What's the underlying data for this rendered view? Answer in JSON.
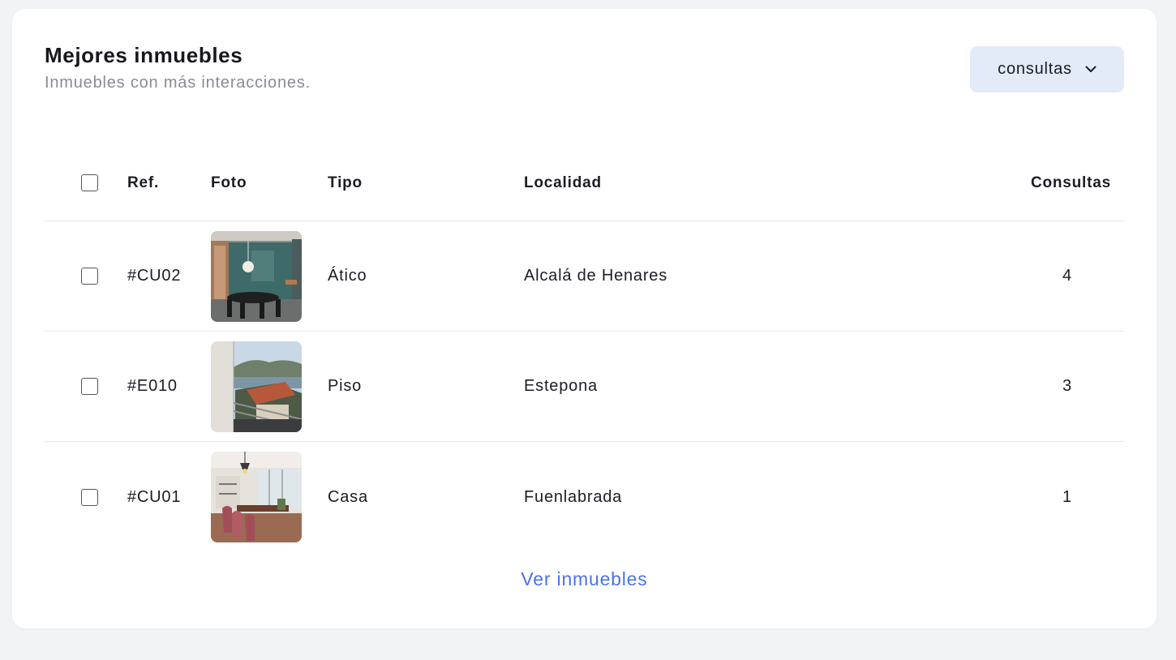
{
  "card": {
    "title": "Mejores inmuebles",
    "subtitle": "Inmuebles con más interacciones.",
    "sort_select": {
      "value": "consultas",
      "icon": "chevron-down-icon"
    }
  },
  "table": {
    "headers": {
      "ref": "Ref.",
      "foto": "Foto",
      "tipo": "Tipo",
      "localidad": "Localidad",
      "consultas": "Consultas"
    },
    "rows": [
      {
        "ref": "#CU02",
        "tipo": "Ático",
        "localidad": "Alcalá de Henares",
        "consultas": "4",
        "photo": "dining-room-photo"
      },
      {
        "ref": "#E010",
        "tipo": "Piso",
        "localidad": "Estepona",
        "consultas": "3",
        "photo": "balcony-view-photo"
      },
      {
        "ref": "#CU01",
        "tipo": "Casa",
        "localidad": "Fuenlabrada",
        "consultas": "1",
        "photo": "dining-room-photo"
      }
    ]
  },
  "footer": {
    "link_label": "Ver inmuebles"
  },
  "colors": {
    "accent": "#4b73e8",
    "button_bg": "#e3eaf8",
    "page_bg": "#f2f3f5"
  }
}
